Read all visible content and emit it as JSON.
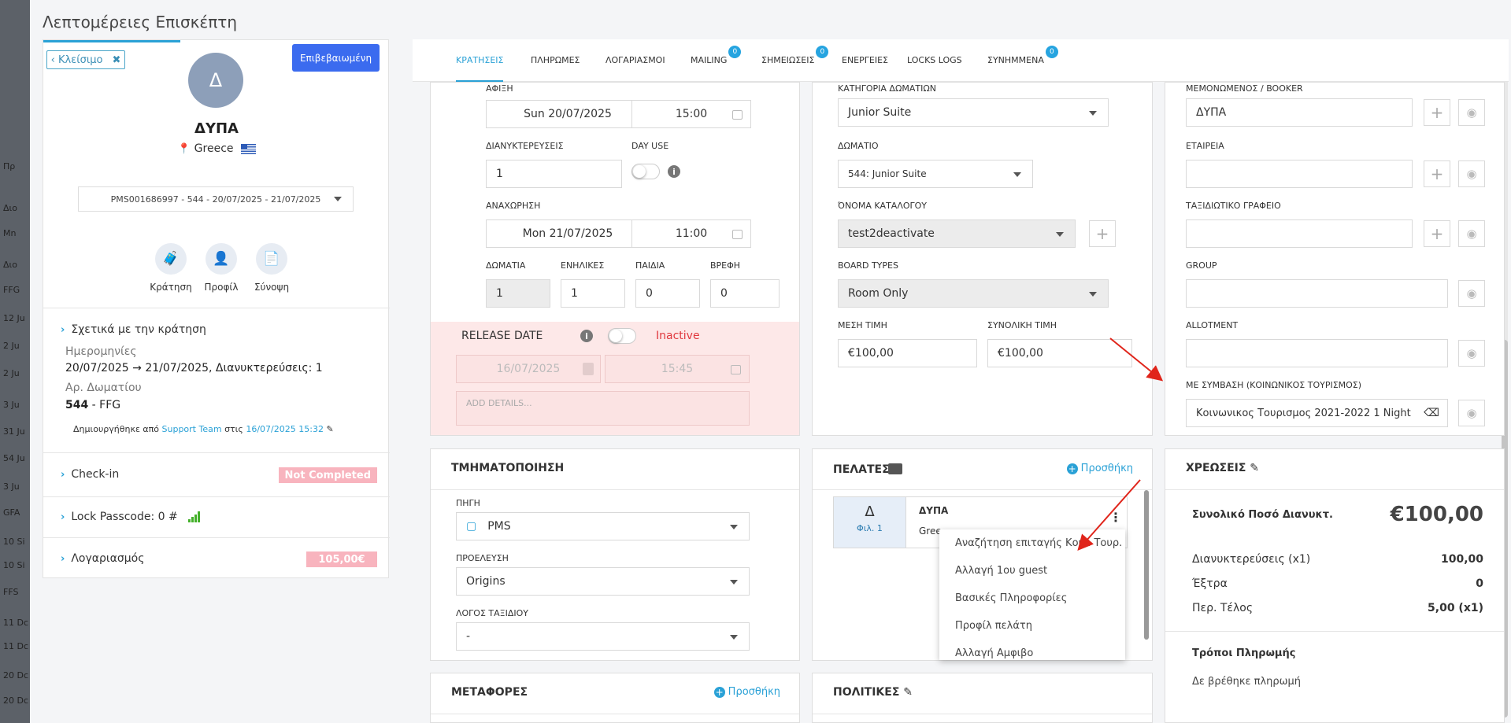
{
  "modal": {
    "title": "Λεπτομέρειες Επισκέπτη"
  },
  "bg_cells": [
    "Πρ",
    "Διο",
    "Mn",
    "Διο",
    "FFG",
    "12 Ju",
    "2 Ju",
    "2 Ju",
    "3 Ju",
    "31 Ju",
    "54 Ju",
    "3 Ju",
    "GFA",
    "10 Si",
    "10 Si",
    "FFS",
    "11 Dc",
    "11 Dc",
    "20 Dc",
    "20 Dc"
  ],
  "left": {
    "close_label": "‹ Κλείσιμο",
    "confirm_label": "Επιβεβαιωμένη",
    "avatar_letter": "Δ",
    "guest_name": "ΔΥΠΑ",
    "country": "Greece",
    "reservation_select": "PMS001686997 - 544 - 20/07/2025 - 21/07/2025",
    "quick": [
      {
        "label": "Κράτηση",
        "icon": "suitcase-icon"
      },
      {
        "label": "Προφίλ",
        "icon": "user-icon"
      },
      {
        "label": "Σύνοψη",
        "icon": "document-icon"
      }
    ],
    "about_title": "Σχετικά με την κράτηση",
    "dates_label": "Ημερομηνίες",
    "dates_value": "20/07/2025 → 21/07/2025, Διανυκτερεύσεις: 1",
    "room_label": "Αρ. Δωματίου",
    "room_number": "544",
    "room_suffix": " - FFG",
    "created_prefix": "Δημιουργήθηκε από ",
    "created_by": "Support Team",
    "created_mid": " στις ",
    "created_at": "16/07/2025 15:32",
    "checkin_label": "Check-in",
    "checkin_status": "Not Completed",
    "lock_label": "Lock Passcode: 0 #",
    "account_label": "Λογαριασμός",
    "account_value": "105,00€"
  },
  "tabs": [
    {
      "label": "ΚΡΑΤΗΣΕΙΣ",
      "active": true
    },
    {
      "label": "ΠΛΗΡΩΜΕΣ"
    },
    {
      "label": "ΛΟΓΑΡΙΑΣΜΟΙ"
    },
    {
      "label": "MAILING",
      "badge": "0"
    },
    {
      "label": "ΣΗΜΕΙΩΣΕΙΣ",
      "badge": "0"
    },
    {
      "label": "ΕΝΕΡΓΕΙΕΣ"
    },
    {
      "label": "LOCKS LOGS"
    },
    {
      "label": "ΣΥΝΗΜΜΕΝΑ",
      "badge": "0"
    }
  ],
  "booking": {
    "arrival_label": "ΑΦΙΞΗ",
    "arrival_date": "Sun 20/07/2025",
    "arrival_time": "15:00",
    "nights_label": "ΔΙΑΝΥΚΤΕΡΕΥΣΕΙΣ",
    "nights": "1",
    "dayuse_label": "DAY USE",
    "departure_label": "ΑΝΑΧΩΡΗΣΗ",
    "departure_date": "Mon 21/07/2025",
    "departure_time": "11:00",
    "rooms_label": "ΔΩΜΑΤΙΑ",
    "rooms": "1",
    "adults_label": "ΕΝΗΛΙΚΕΣ",
    "adults": "1",
    "children_label": "ΠΑΙΔΙΑ",
    "children": "0",
    "infants_label": "ΒΡΕΦΗ",
    "infants": "0",
    "release_label": "RELEASE DATE",
    "release_status": "Inactive",
    "release_date": "16/07/2025",
    "release_time": "15:45",
    "details_placeholder": "ADD DETAILS..."
  },
  "room": {
    "category_label": "ΚΑΤΗΓΟΡΙΑ ΔΩΜΑΤΙΩΝ",
    "category": "Junior Suite",
    "room_label": "ΔΩΜΑΤΙΟ",
    "room": "544: Junior Suite",
    "catalog_label": "ΌΝΟΜΑ ΚΑΤΑΛΟΓΟΥ",
    "catalog": "test2deactivate",
    "board_label": "BOARD TYPES",
    "board": "Room Only",
    "avg_label": "ΜΕΣΗ ΤΙΜΗ",
    "avg": "€100,00",
    "total_label": "ΣΥΝΟΛΙΚΗ ΤΙΜΗ",
    "total": "€100,00"
  },
  "booker": {
    "booker_label": "ΜΕΜΟΝΩΜΕΝΟΣ / BOOKER",
    "booker": "ΔΥΠΑ",
    "company_label": "ΕΤΑΙΡΕΙΑ",
    "agency_label": "ΤΑΞΙΔΙΩΤΙΚΟ ΓΡΑΦΕΙΟ",
    "group_label": "GROUP",
    "allotment_label": "ALLOTMENT",
    "contract_label": "ΜΕ ΣΥΜΒΑΣΗ (ΚΟΙΝΩΝΙΚΟΣ ΤΟΥΡΙΣΜΟΣ)",
    "contract": "Κοινωνικος Τουρισμος 2021-2022 1 Night"
  },
  "segmentation": {
    "title": "ΤΜΗΜΑΤΟΠΟΙΗΣΗ",
    "source_label": "ΠΗΓΗ",
    "source": "PMS",
    "origin_label": "ΠΡΟΕΛΕΥΣΗ",
    "origin": "Origins",
    "reason_label": "ΛΟΓΟΣ ΤΑΞΙΔΙΟΥ",
    "reason": "-"
  },
  "customers": {
    "title": "ΠΕΛΑΤΕΣ",
    "add": "Προσθήκη",
    "letter": "Δ",
    "sub": "Φιλ. 1",
    "name": "ΔΥΠΑ",
    "country": "Gree",
    "menu": [
      "Αναζήτηση επιταγής Κοιν. Τουρ.",
      "Αλλαγή 1ου guest",
      "Βασικές Πληροφορίες",
      "Προφίλ πελάτη",
      "Αλλαγή Αμφιβο"
    ]
  },
  "charges": {
    "title": "ΧΡΕΩΣΕΙΣ",
    "total_label": "Συνολικό Ποσό Διανυκτ.",
    "total": "€100,00",
    "rows": [
      {
        "label": "Διανυκτερεύσεις (x1)",
        "value": "100,00"
      },
      {
        "label": "Έξτρα",
        "value": "0"
      },
      {
        "label": "Περ. Τέλος",
        "value": "5,00 (x1)"
      }
    ],
    "payments_title": "Τρόποι Πληρωμής",
    "payments_empty": "Δε βρέθηκε πληρωμή"
  },
  "transfers": {
    "title": "ΜΕΤΑΦΟΡΕΣ",
    "add": "Προσθήκη"
  },
  "policies": {
    "title": "ΠΟΛΙΤΙΚΕΣ"
  },
  "colors": {
    "accent": "#2aa1d6",
    "primary": "#3b6bef",
    "badge_red": "#f8b4be",
    "inactive": "#e0383e",
    "arrow": "#e0251b"
  }
}
